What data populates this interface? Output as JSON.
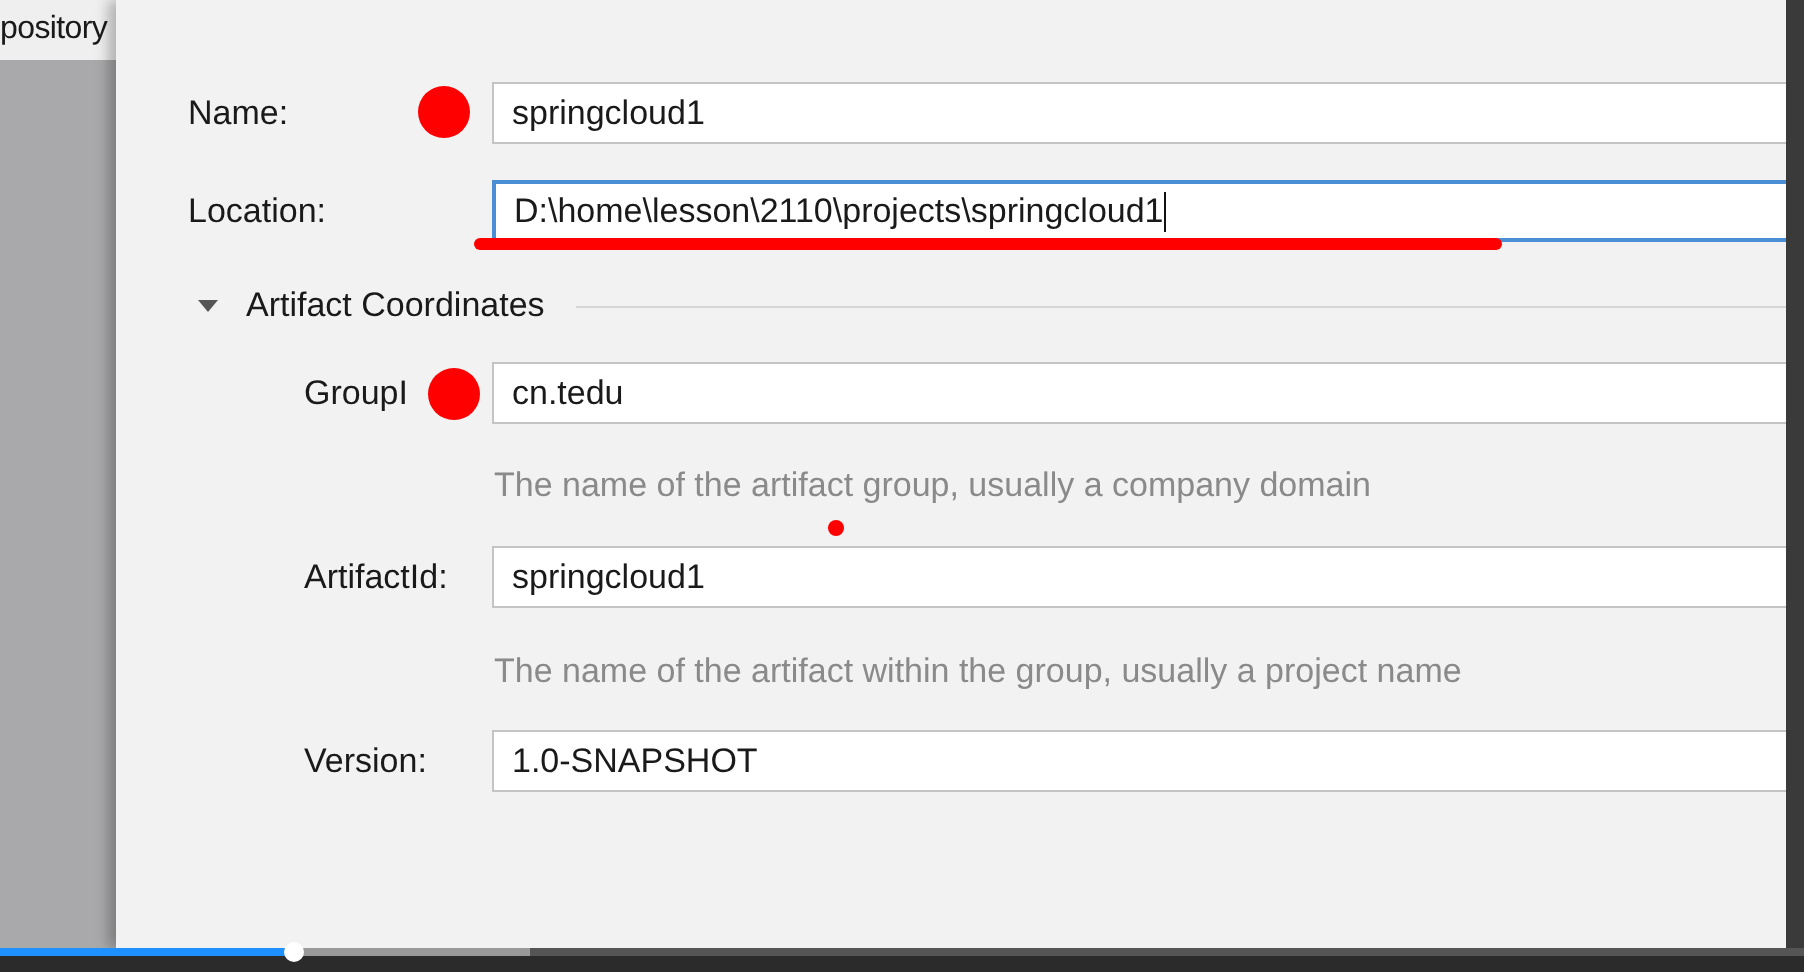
{
  "background_window": {
    "text": "pository"
  },
  "form": {
    "name": {
      "label": "Name:",
      "value": "springcloud1",
      "focused": false
    },
    "location": {
      "label": "Location:",
      "value": "D:\\home\\lesson\\2110\\projects\\springcloud1",
      "focused": true
    },
    "section": {
      "title": "Artifact Coordinates",
      "expanded": true
    },
    "group_id": {
      "label": "GroupI",
      "value": "cn.tedu",
      "hint": "The name of the artifact group, usually a company domain"
    },
    "artifact_id": {
      "label": "ArtifactId:",
      "value": "springcloud1",
      "hint": "The name of the artifact within the group, usually a project name"
    },
    "version": {
      "label": "Version:",
      "value": "1.0-SNAPSHOT"
    }
  },
  "video_progress": {
    "level": 0.163
  }
}
